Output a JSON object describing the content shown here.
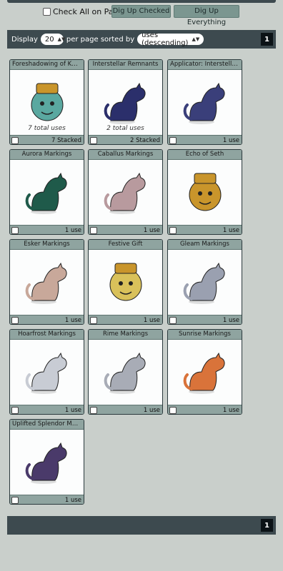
{
  "actions": {
    "check_all_label": "Check All on Page",
    "dig_up_checked": "Dig Up Checked",
    "dig_up_everything": "Dig Up Everything"
  },
  "pager": {
    "display_label": "Display",
    "per_page": "20",
    "sorted_label": "per page sorted by",
    "sort": "uses (descending)",
    "page": "1"
  },
  "items": [
    {
      "name": "Foreshadowing of Khnum",
      "total": "7 total uses",
      "count": "7 Stacked",
      "art": "khnum-icon",
      "color": "#5aa8a0"
    },
    {
      "name": "Interstellar Remnants",
      "total": "2 total uses",
      "count": "2 Stacked",
      "art": "interstellar-cat-icon",
      "color": "#2b2f6b"
    },
    {
      "name": "Applicator: Interstellar Ma...",
      "total": "",
      "count": "1 use",
      "art": "interstellar-cat-sitting-icon",
      "color": "#3a3f7a"
    },
    {
      "name": "Aurora Markings",
      "total": "",
      "count": "1 use",
      "art": "aurora-cat-icon",
      "color": "#1f5a4a"
    },
    {
      "name": "Caballus Markings",
      "total": "",
      "count": "1 use",
      "art": "caballus-cat-icon",
      "color": "#b89a9e"
    },
    {
      "name": "Echo of Seth",
      "total": "",
      "count": "1 use",
      "art": "seth-mask-icon",
      "color": "#c9952b"
    },
    {
      "name": "Esker Markings",
      "total": "",
      "count": "1 use",
      "art": "esker-cat-icon",
      "color": "#c8a89a"
    },
    {
      "name": "Festive Gift",
      "total": "",
      "count": "1 use",
      "art": "festive-gift-icon",
      "color": "#d9c15a"
    },
    {
      "name": "Gleam Markings",
      "total": "",
      "count": "1 use",
      "art": "gleam-cat-icon",
      "color": "#9aa0b0"
    },
    {
      "name": "Hoarfrost Markings",
      "total": "",
      "count": "1 use",
      "art": "hoarfrost-cat-icon",
      "color": "#c8ccd4"
    },
    {
      "name": "Rime Markings",
      "total": "",
      "count": "1 use",
      "art": "rime-cat-icon",
      "color": "#a8acb6"
    },
    {
      "name": "Sunrise Markings",
      "total": "",
      "count": "1 use",
      "art": "sunrise-cat-icon",
      "color": "#d9733a"
    },
    {
      "name": "Uplifted Splendor Markings",
      "total": "",
      "count": "1 use",
      "art": "uplifted-splendor-cat-icon",
      "color": "#4a3a6a"
    }
  ]
}
